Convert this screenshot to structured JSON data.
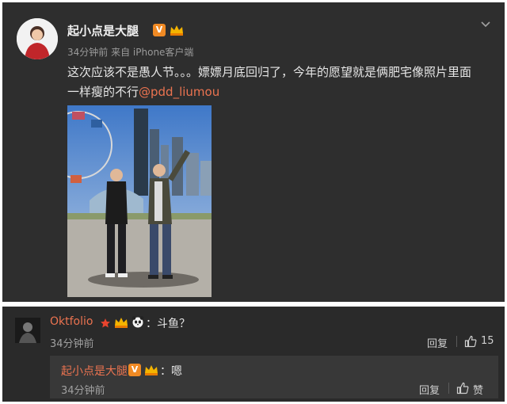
{
  "post": {
    "author": "起小点是大腿",
    "verified_badge": "V",
    "time": "34分钟前",
    "source": "来自 iPhone客户端",
    "text_line1": "这次应该不是愚人节。。。嫖嫖月底回归了，今年的愿望就是俩肥宅像照片里面",
    "text_line2_prefix": "一样瘦的不行",
    "mention": "@pdd_liumou",
    "chevron_icon": "chevron-down-icon"
  },
  "comments": [
    {
      "author": "Oktfolio",
      "text": "：斗鱼？",
      "time": "34分钟前",
      "reply_label": "回复",
      "like_count": "15"
    }
  ],
  "reply": {
    "author": "起小点是大腿",
    "verified_badge": "V",
    "text": "：嗯",
    "time": "34分钟前",
    "reply_label": "回复",
    "like_label": "赞"
  },
  "colors": {
    "background": "#2e2e2e",
    "accent": "#eb7350",
    "badge": "#f08a24"
  }
}
